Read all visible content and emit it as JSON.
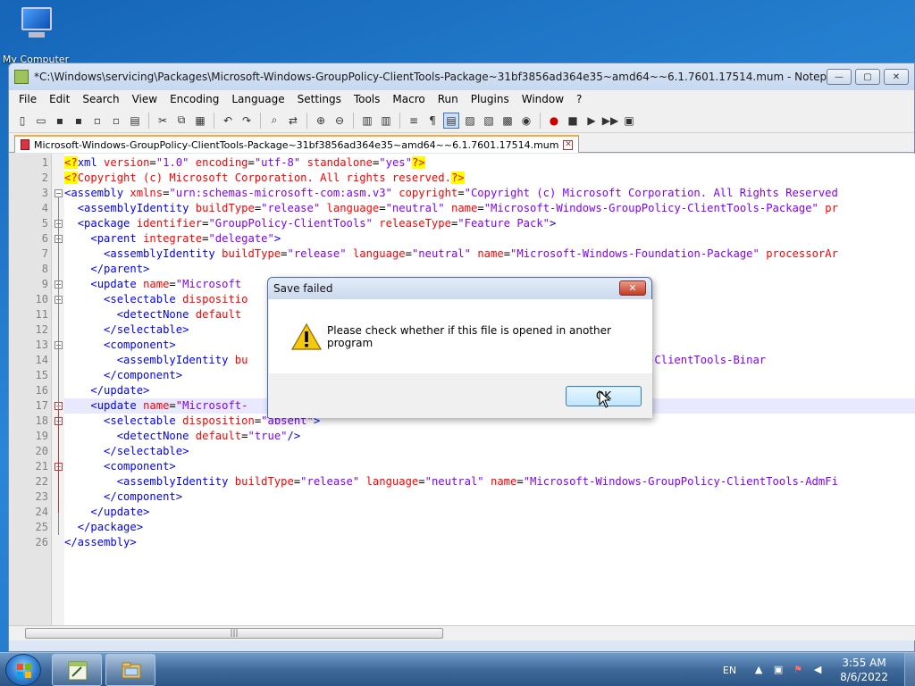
{
  "desktop": {
    "icon_label": "My Computer"
  },
  "window": {
    "title": "*C:\\Windows\\servicing\\Packages\\Microsoft-Windows-GroupPolicy-ClientTools-Package~31bf3856ad364e35~amd64~~6.1.7601.17514.mum - Notepad++ [Administrator]",
    "controls": {
      "minimize": "—",
      "maximize": "▢",
      "close": "✕"
    }
  },
  "menu": [
    "File",
    "Edit",
    "Search",
    "View",
    "Encoding",
    "Language",
    "Settings",
    "Tools",
    "Macro",
    "Run",
    "Plugins",
    "Window",
    "?"
  ],
  "toolbar_icons": [
    "new-file-icon",
    "open-file-icon",
    "save-icon",
    "save-all-icon",
    "close-icon",
    "close-all-icon",
    "print-icon",
    "cut-icon",
    "copy-icon",
    "paste-icon",
    "undo-icon",
    "redo-icon",
    "find-icon",
    "replace-icon",
    "zoom-in-icon",
    "zoom-out-icon",
    "sync-vertical-icon",
    "sync-horizontal-icon",
    "word-wrap-icon",
    "show-all-chars-icon",
    "indent-guide-icon",
    "doc-map-icon",
    "function-list-icon",
    "folder-workspace-icon",
    "monitoring-icon",
    "record-macro-icon",
    "stop-record-icon",
    "play-macro-icon",
    "run-macro-multiple-icon",
    "save-macro-icon"
  ],
  "tab": {
    "label": "Microsoft-Windows-GroupPolicy-ClientTools-Package~31bf3856ad364e35~amd64~~6.1.7601.17514.mum"
  },
  "editor": {
    "current_line": 17,
    "lines": [
      {
        "n": "1",
        "tokens": [
          [
            "pi",
            "<?"
          ],
          [
            "tag",
            "xml "
          ],
          [
            "attr",
            "version"
          ],
          [
            "txt",
            "="
          ],
          [
            "val",
            "\"1.0\""
          ],
          [
            "txt",
            " "
          ],
          [
            "attr",
            "encoding"
          ],
          [
            "txt",
            "="
          ],
          [
            "val",
            "\"utf-8\""
          ],
          [
            "txt",
            " "
          ],
          [
            "attr",
            "standalone"
          ],
          [
            "txt",
            "="
          ],
          [
            "val",
            "\"yes\""
          ],
          [
            "pi",
            "?>"
          ]
        ]
      },
      {
        "n": "2",
        "tokens": [
          [
            "pi",
            "<?"
          ],
          [
            "attr",
            "Copyright (c) Microsoft Corporation. All rights reserved."
          ],
          [
            "pi",
            "?>"
          ]
        ]
      },
      {
        "n": "3",
        "tokens": [
          [
            "tag",
            "<assembly "
          ],
          [
            "attr",
            "xmlns"
          ],
          [
            "txt",
            "="
          ],
          [
            "val",
            "\"urn:schemas-microsoft-com:asm.v3\""
          ],
          [
            "txt",
            " "
          ],
          [
            "attr",
            "copyright"
          ],
          [
            "txt",
            "="
          ],
          [
            "val",
            "\"Copyright (c) Microsoft Corporation. All Rights Reserved"
          ]
        ]
      },
      {
        "n": "4",
        "tokens": [
          [
            "txt",
            "  "
          ],
          [
            "tag",
            "<assemblyIdentity "
          ],
          [
            "attr",
            "buildType"
          ],
          [
            "txt",
            "="
          ],
          [
            "val",
            "\"release\""
          ],
          [
            "txt",
            " "
          ],
          [
            "attr",
            "language"
          ],
          [
            "txt",
            "="
          ],
          [
            "val",
            "\"neutral\""
          ],
          [
            "txt",
            " "
          ],
          [
            "attr",
            "name"
          ],
          [
            "txt",
            "="
          ],
          [
            "val",
            "\"Microsoft-Windows-GroupPolicy-ClientTools-Package\""
          ],
          [
            "txt",
            " "
          ],
          [
            "attr",
            "pr"
          ]
        ]
      },
      {
        "n": "5",
        "tokens": [
          [
            "txt",
            "  "
          ],
          [
            "tag",
            "<package "
          ],
          [
            "attr",
            "identifier"
          ],
          [
            "txt",
            "="
          ],
          [
            "val",
            "\"GroupPolicy-ClientTools\""
          ],
          [
            "txt",
            " "
          ],
          [
            "attr",
            "releaseType"
          ],
          [
            "txt",
            "="
          ],
          [
            "val",
            "\"Feature Pack\""
          ],
          [
            "tag",
            ">"
          ]
        ]
      },
      {
        "n": "6",
        "tokens": [
          [
            "txt",
            "    "
          ],
          [
            "tag",
            "<parent "
          ],
          [
            "attr",
            "integrate"
          ],
          [
            "txt",
            "="
          ],
          [
            "val",
            "\"delegate\""
          ],
          [
            "tag",
            ">"
          ]
        ]
      },
      {
        "n": "7",
        "tokens": [
          [
            "txt",
            "      "
          ],
          [
            "tag",
            "<assemblyIdentity "
          ],
          [
            "attr",
            "buildType"
          ],
          [
            "txt",
            "="
          ],
          [
            "val",
            "\"release\""
          ],
          [
            "txt",
            " "
          ],
          [
            "attr",
            "language"
          ],
          [
            "txt",
            "="
          ],
          [
            "val",
            "\"neutral\""
          ],
          [
            "txt",
            " "
          ],
          [
            "attr",
            "name"
          ],
          [
            "txt",
            "="
          ],
          [
            "val",
            "\"Microsoft-Windows-Foundation-Package\""
          ],
          [
            "txt",
            " "
          ],
          [
            "attr",
            "processorAr"
          ]
        ]
      },
      {
        "n": "8",
        "tokens": [
          [
            "txt",
            "    "
          ],
          [
            "tag",
            "</parent>"
          ]
        ]
      },
      {
        "n": "9",
        "tokens": [
          [
            "txt",
            "    "
          ],
          [
            "tag",
            "<update "
          ],
          [
            "attr",
            "name"
          ],
          [
            "txt",
            "="
          ],
          [
            "val",
            "\"Microsoft"
          ]
        ]
      },
      {
        "n": "10",
        "tokens": [
          [
            "txt",
            "      "
          ],
          [
            "tag",
            "<selectable "
          ],
          [
            "attr",
            "dispositio"
          ]
        ]
      },
      {
        "n": "11",
        "tokens": [
          [
            "txt",
            "        "
          ],
          [
            "tag",
            "<detectNone "
          ],
          [
            "attr",
            "default"
          ]
        ]
      },
      {
        "n": "12",
        "tokens": [
          [
            "txt",
            "      "
          ],
          [
            "tag",
            "</selectable>"
          ]
        ]
      },
      {
        "n": "13",
        "tokens": [
          [
            "txt",
            "      "
          ],
          [
            "tag",
            "<component>"
          ]
        ]
      },
      {
        "n": "14",
        "tokens": [
          [
            "txt",
            "        "
          ],
          [
            "tag",
            "<assemblyIdentity "
          ],
          [
            "attr",
            "bu"
          ],
          [
            "txt",
            "                                          "
          ],
          [
            "val",
            "Windows-GroupPolicy-ClientTools-Binar"
          ]
        ]
      },
      {
        "n": "15",
        "tokens": [
          [
            "txt",
            "      "
          ],
          [
            "tag",
            "</component>"
          ]
        ]
      },
      {
        "n": "16",
        "tokens": [
          [
            "txt",
            "    "
          ],
          [
            "tag",
            "</update>"
          ]
        ]
      },
      {
        "n": "17",
        "tokens": [
          [
            "txt",
            "    "
          ],
          [
            "tag",
            "<update "
          ],
          [
            "attr",
            "name"
          ],
          [
            "txt",
            "="
          ],
          [
            "val",
            "\"Microsoft-"
          ]
        ]
      },
      {
        "n": "18",
        "tokens": [
          [
            "txt",
            "      "
          ],
          [
            "tag",
            "<selectable "
          ],
          [
            "attr",
            "disposition"
          ],
          [
            "txt",
            "="
          ],
          [
            "val",
            "\"absent\""
          ],
          [
            "tag",
            ">"
          ]
        ]
      },
      {
        "n": "19",
        "tokens": [
          [
            "txt",
            "        "
          ],
          [
            "tag",
            "<detectNone "
          ],
          [
            "attr",
            "default"
          ],
          [
            "txt",
            "="
          ],
          [
            "val",
            "\"true\""
          ],
          [
            "tag",
            "/>"
          ]
        ]
      },
      {
        "n": "20",
        "tokens": [
          [
            "txt",
            "      "
          ],
          [
            "tag",
            "</selectable>"
          ]
        ]
      },
      {
        "n": "21",
        "tokens": [
          [
            "txt",
            "      "
          ],
          [
            "tag",
            "<component>"
          ]
        ]
      },
      {
        "n": "22",
        "tokens": [
          [
            "txt",
            "        "
          ],
          [
            "tag",
            "<assemblyIdentity "
          ],
          [
            "attr",
            "buildType"
          ],
          [
            "txt",
            "="
          ],
          [
            "val",
            "\"release\""
          ],
          [
            "txt",
            " "
          ],
          [
            "attr",
            "language"
          ],
          [
            "txt",
            "="
          ],
          [
            "val",
            "\"neutral\""
          ],
          [
            "txt",
            " "
          ],
          [
            "attr",
            "name"
          ],
          [
            "txt",
            "="
          ],
          [
            "val",
            "\"Microsoft-Windows-GroupPolicy-ClientTools-AdmFi"
          ]
        ]
      },
      {
        "n": "23",
        "tokens": [
          [
            "txt",
            "      "
          ],
          [
            "tag",
            "</component>"
          ]
        ]
      },
      {
        "n": "24",
        "tokens": [
          [
            "txt",
            "    "
          ],
          [
            "tag",
            "</update>"
          ]
        ]
      },
      {
        "n": "25",
        "tokens": [
          [
            "txt",
            "  "
          ],
          [
            "tag",
            "</package>"
          ]
        ]
      },
      {
        "n": "26",
        "tokens": [
          [
            "tag",
            "</assembly>"
          ]
        ]
      }
    ]
  },
  "dialog": {
    "title": "Save failed",
    "message": "Please check whether if this file is opened in another program",
    "ok_label": "OK",
    "close_glyph": "✕"
  },
  "taskbar": {
    "language": "EN",
    "time": "3:55 AM",
    "date": "8/6/2022"
  }
}
